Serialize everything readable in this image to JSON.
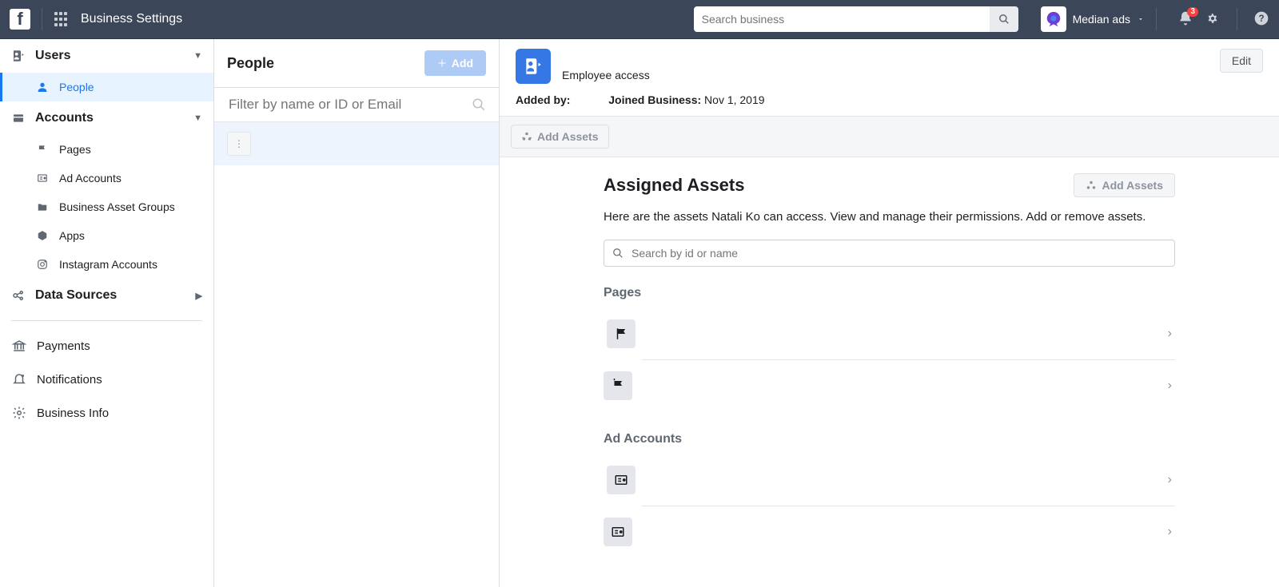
{
  "topbar": {
    "page_title": "Business Settings",
    "search_placeholder": "Search business",
    "account_name": "Median ads",
    "notif_count": "3"
  },
  "sidebar": {
    "users": {
      "label": "Users"
    },
    "people": {
      "label": "People"
    },
    "accounts": {
      "label": "Accounts"
    },
    "pages": {
      "label": "Pages"
    },
    "ad_accounts": {
      "label": "Ad Accounts"
    },
    "bag": {
      "label": "Business Asset Groups"
    },
    "apps": {
      "label": "Apps"
    },
    "ig": {
      "label": "Instagram Accounts"
    },
    "data_sources": {
      "label": "Data Sources"
    },
    "payments": {
      "label": "Payments"
    },
    "notifications": {
      "label": "Notifications"
    },
    "business_info": {
      "label": "Business Info"
    }
  },
  "people_col": {
    "heading": "People",
    "add_label": "Add",
    "filter_placeholder": "Filter by name or ID or Email",
    "list": [
      {
        "name": ""
      }
    ]
  },
  "detail": {
    "role": "Employee access",
    "edit_label": "Edit",
    "added_by_label": "Added by:",
    "added_by_value": "",
    "joined_label": "Joined Business:",
    "joined_value": "Nov 1, 2019",
    "add_assets_label": "Add Assets",
    "assigned_title": "Assigned Assets",
    "assigned_desc": "Here are the assets Natali Ko can access. View and manage their permissions. Add or remove assets.",
    "search_placeholder": "Search by id or name",
    "sections": {
      "pages": {
        "title": "Pages",
        "items": [
          {
            "name": ""
          },
          {
            "name": ""
          }
        ]
      },
      "ad_accounts": {
        "title": "Ad Accounts",
        "items": [
          {
            "name": ""
          },
          {
            "name": ""
          }
        ]
      }
    }
  }
}
